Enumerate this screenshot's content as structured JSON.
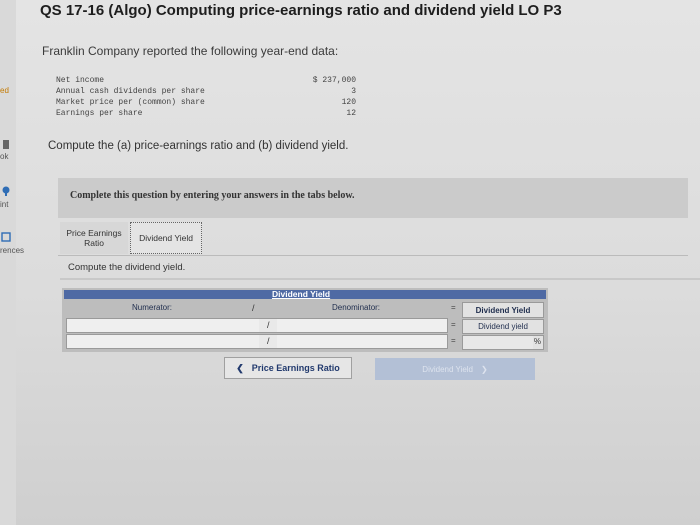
{
  "title": "QS 17-16 (Algo) Computing price-earnings ratio and dividend yield LO P3",
  "intro": "Franklin Company reported the following year-end data:",
  "data_rows": [
    {
      "label": "Net income",
      "value": "$ 237,000"
    },
    {
      "label": "Annual cash dividends per share",
      "value": "3"
    },
    {
      "label": "Market price per (common) share",
      "value": "120"
    },
    {
      "label": "Earnings per share",
      "value": "12"
    }
  ],
  "question": "Compute the (a) price-earnings ratio and (b) dividend yield.",
  "complete_text": "Complete this question by entering your answers in the tabs below.",
  "tabs": [
    {
      "label": "Price Earnings Ratio"
    },
    {
      "label": "Dividend Yield"
    }
  ],
  "instruction": "Compute the dividend yield.",
  "table": {
    "title": "Dividend Yield",
    "numerator_label": "Numerator:",
    "denominator_label": "Denominator:",
    "result_header": "Dividend Yield",
    "result_row_label": "Dividend yield",
    "slash": "/",
    "equals": "=",
    "percent": "%"
  },
  "nav": {
    "prev_label": "Price Earnings Ratio",
    "next_label": "Dividend Yield"
  },
  "sidebar": {
    "items": [
      "ed",
      "ok",
      "int",
      "rences"
    ]
  },
  "colors": {
    "header_blue": "#4f6aa4",
    "link_blue": "#223a6e"
  }
}
